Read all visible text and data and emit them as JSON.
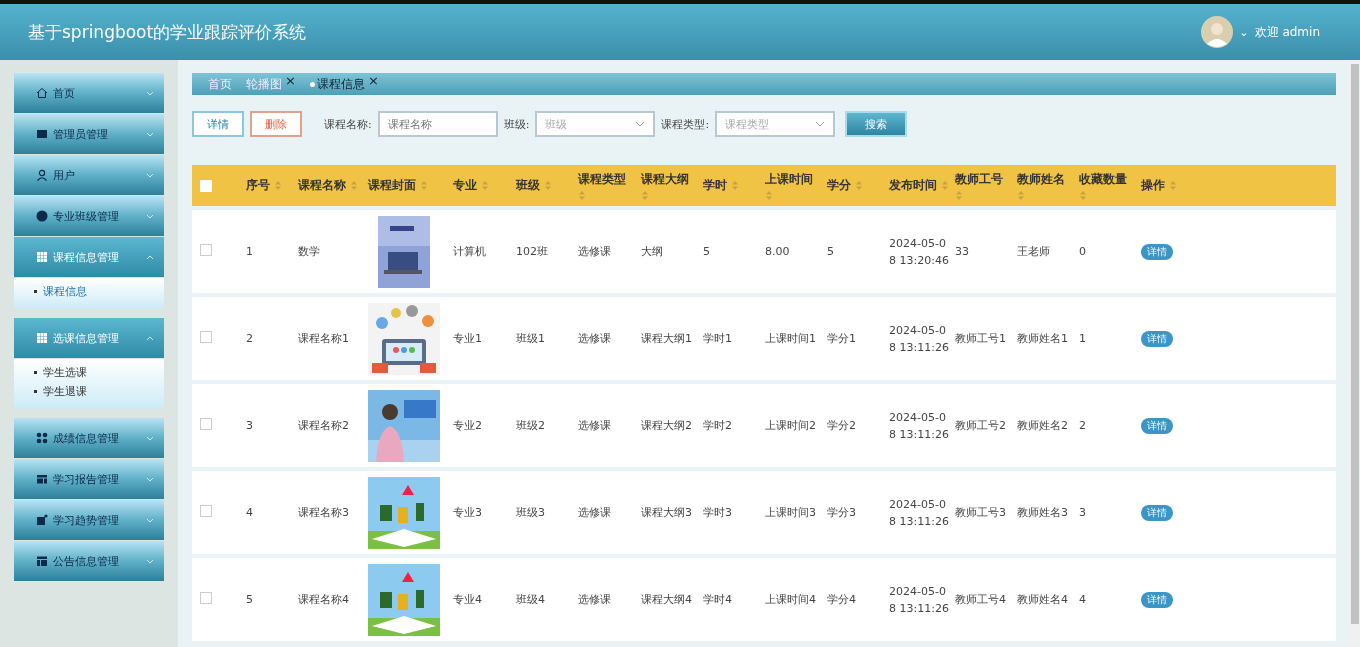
{
  "header": {
    "title": "基于springboot的学业跟踪评价系统",
    "user_caret": "⌄",
    "welcome": "欢迎 admin"
  },
  "sidebar": {
    "items": [
      {
        "label": "首页",
        "expanded": false
      },
      {
        "label": "管理员管理",
        "expanded": false
      },
      {
        "label": "用户",
        "expanded": false
      },
      {
        "label": "专业班级管理",
        "expanded": false
      },
      {
        "label": "课程信息管理",
        "expanded": true,
        "children": [
          {
            "label": "课程信息",
            "selected": true
          }
        ]
      },
      {
        "label": "选课信息管理",
        "expanded": true,
        "children": [
          {
            "label": "学生选课",
            "selected": false
          },
          {
            "label": "学生退课",
            "selected": false
          }
        ]
      },
      {
        "label": "成绩信息管理",
        "expanded": false
      },
      {
        "label": "学习报告管理",
        "expanded": false
      },
      {
        "label": "学习趋势管理",
        "expanded": false
      },
      {
        "label": "公告信息管理",
        "expanded": false
      }
    ]
  },
  "tabs": [
    {
      "label": "首页",
      "selected": false,
      "closable": false
    },
    {
      "label": "轮播图",
      "selected": false,
      "closable": true
    },
    {
      "label": "课程信息",
      "selected": true,
      "closable": true
    }
  ],
  "close_glyph": "×",
  "toolbar": {
    "detail_button": "详情",
    "delete_button": "删除",
    "filters": [
      {
        "kind": "input",
        "label": "课程名称:",
        "placeholder": "课程名称"
      },
      {
        "kind": "select",
        "label": "班级:",
        "placeholder": "班级"
      },
      {
        "kind": "select",
        "label": "课程类型:",
        "placeholder": "课程类型"
      }
    ],
    "search_button": "搜索"
  },
  "table": {
    "all_checked": false,
    "columns": [
      "序号",
      "课程名称",
      "课程封面",
      "专业",
      "班级",
      "课程类型",
      "课程大纲",
      "学时",
      "上课时间",
      "学分",
      "发布时间",
      "教师工号",
      "教师姓名",
      "收藏数量",
      "操作"
    ],
    "rows": [
      {
        "checked": false,
        "cells": [
          "1",
          "数学",
          "",
          "计算机",
          "102班",
          "选修课",
          "大纲",
          "5",
          "8.00",
          "5",
          "2024-05-08 13:20:46",
          "33",
          "王老师",
          "0"
        ],
        "action": "详情"
      },
      {
        "checked": false,
        "cells": [
          "2",
          "课程名称1",
          "",
          "专业1",
          "班级1",
          "选修课",
          "课程大纲1",
          "学时1",
          "上课时间1",
          "学分1",
          "2024-05-08 13:11:26",
          "教师工号1",
          "教师姓名1",
          "1"
        ],
        "action": "详情"
      },
      {
        "checked": false,
        "cells": [
          "3",
          "课程名称2",
          "",
          "专业2",
          "班级2",
          "选修课",
          "课程大纲2",
          "学时2",
          "上课时间2",
          "学分2",
          "2024-05-08 13:11:26",
          "教师工号2",
          "教师姓名2",
          "2"
        ],
        "action": "详情"
      },
      {
        "checked": false,
        "cells": [
          "4",
          "课程名称3",
          "",
          "专业3",
          "班级3",
          "选修课",
          "课程大纲3",
          "学时3",
          "上课时间3",
          "学分3",
          "2024-05-08 13:11:26",
          "教师工号3",
          "教师姓名3",
          "3"
        ],
        "action": "详情"
      },
      {
        "checked": false,
        "cells": [
          "5",
          "课程名称4",
          "",
          "专业4",
          "班级4",
          "选修课",
          "课程大纲4",
          "学时4",
          "上课时间4",
          "学分4",
          "2024-05-08 13:11:26",
          "教师工号4",
          "教师姓名4",
          "4"
        ],
        "action": "详情"
      }
    ]
  }
}
